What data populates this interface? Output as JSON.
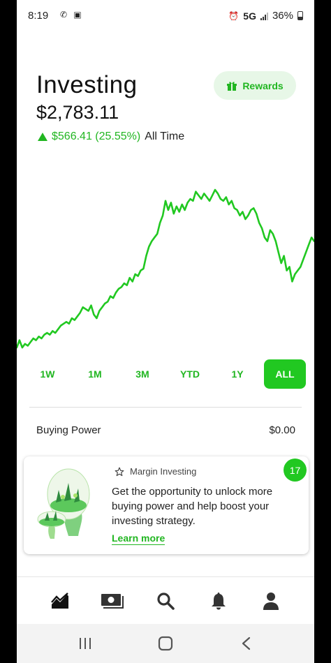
{
  "status_bar": {
    "time": "8:19",
    "network": "5G",
    "battery": "36%",
    "icons": [
      "phone-call-icon",
      "app-notification-icon",
      "alarm-icon",
      "signal-icon",
      "battery-icon"
    ]
  },
  "header": {
    "title": "Investing",
    "balance": "$2,783.11",
    "change_amount": "$566.41 (25.55%)",
    "change_period": "All Time",
    "change_direction": "up",
    "rewards_label": "Rewards"
  },
  "colors": {
    "accent": "#21c821",
    "accent_text": "#21b621",
    "rewards_bg": "#e7f7e7"
  },
  "chart_data": {
    "type": "line",
    "y": [
      0,
      4,
      0,
      2,
      1,
      3,
      5,
      4,
      6,
      5,
      7,
      8,
      7,
      9,
      8,
      10,
      12,
      13,
      14,
      13,
      16,
      15,
      17,
      19,
      22,
      21,
      20,
      23,
      18,
      16,
      20,
      22,
      24,
      25,
      28,
      27,
      30,
      32,
      33,
      35,
      34,
      38,
      36,
      40,
      39,
      42,
      43,
      50,
      55,
      58,
      60,
      62,
      68,
      72,
      80,
      75,
      79,
      73,
      77,
      74,
      78,
      75,
      79,
      81,
      80,
      85,
      83,
      81,
      84,
      82,
      80,
      83,
      86,
      84,
      81,
      80,
      82,
      78,
      80,
      76,
      75,
      72,
      74,
      70,
      72,
      75,
      76,
      73,
      68,
      65,
      60,
      58,
      64,
      62,
      58,
      52,
      46,
      50,
      42,
      44,
      36,
      40,
      42,
      44,
      48,
      52,
      56,
      60,
      58
    ],
    "grid": false,
    "legend": "none"
  },
  "time_ranges": {
    "options": [
      "1W",
      "1M",
      "3M",
      "YTD",
      "1Y",
      "ALL"
    ],
    "selected": "ALL"
  },
  "buying_power": {
    "label": "Buying Power",
    "value": "$0.00"
  },
  "promo_card": {
    "tag": "Margin Investing",
    "description": "Get the opportunity to unlock more buying power and help boost your investing strategy.",
    "link": "Learn more",
    "badge_count": "17"
  },
  "bottom_nav": {
    "items": [
      "investing-chart-icon",
      "cash-card-icon",
      "search-icon",
      "notifications-bell-icon",
      "account-person-icon"
    ],
    "active": "investing-chart-icon"
  },
  "system_nav": {
    "items": [
      "recent-apps-icon",
      "home-icon",
      "back-icon"
    ]
  }
}
